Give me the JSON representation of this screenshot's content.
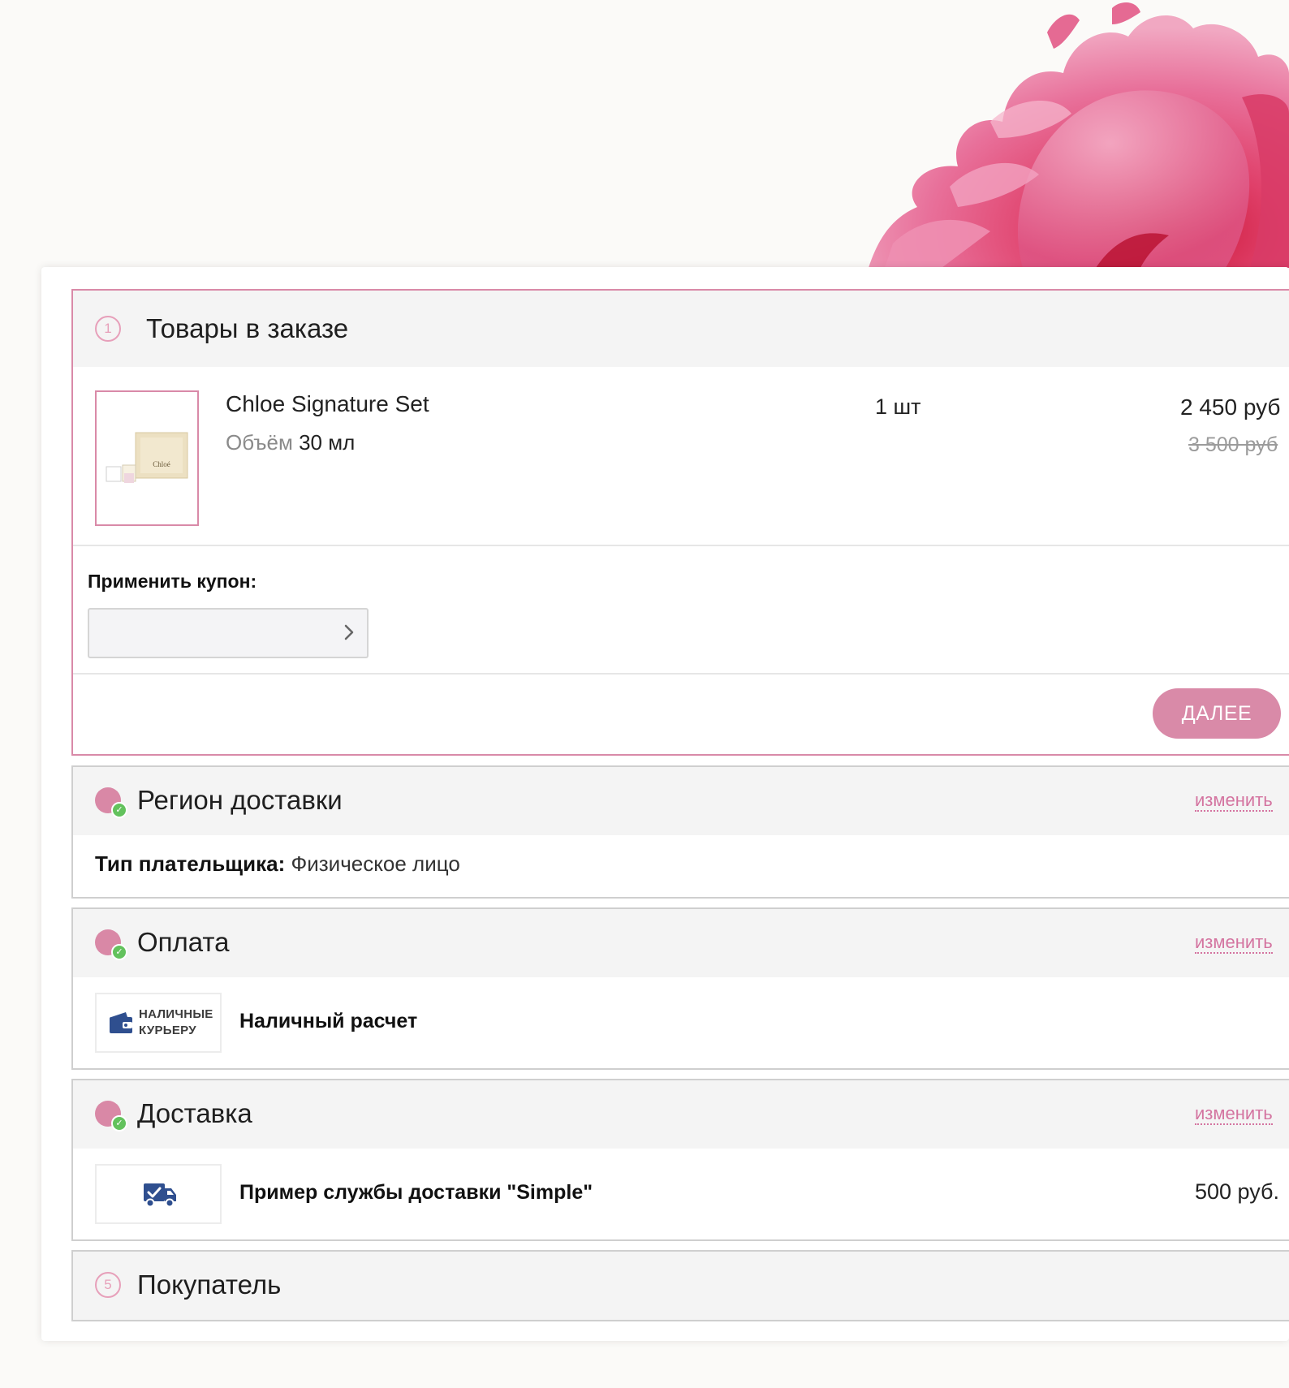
{
  "colors": {
    "accent_pink": "#d98aa8",
    "link_pink": "#d474a0",
    "check_green": "#63c25d",
    "icon_blue": "#2f4f8f"
  },
  "items_section": {
    "number": "1",
    "title": "Товары в заказе",
    "product": {
      "name": "Chloe Signature Set",
      "prop_label": "Объём",
      "prop_value": "30 мл",
      "quantity": "1 шт",
      "price": "2 450 руб",
      "old_price": "3 500 руб",
      "thumb_brand": "Chloé"
    },
    "coupon_label": "Применить купон:",
    "coupon_value": "",
    "coupon_placeholder": "",
    "next_label": "ДАЛЕЕ"
  },
  "region_section": {
    "title": "Регион доставки",
    "change_label": "изменить",
    "payer_label": "Тип плательщика:",
    "payer_value": "Физическое лицо"
  },
  "payment_section": {
    "title": "Оплата",
    "change_label": "изменить",
    "logo_line1": "НАЛИЧНЫЕ",
    "logo_line2": "КУРЬЕРУ",
    "method": "Наличный расчет",
    "logo_icon": "wallet-icon"
  },
  "delivery_section": {
    "title": "Доставка",
    "change_label": "изменить",
    "method": "Пример службы доставки \"Simple\"",
    "price": "500 руб.",
    "logo_icon": "truck-check-icon"
  },
  "buyer_section": {
    "number": "5",
    "title": "Покупатель"
  }
}
